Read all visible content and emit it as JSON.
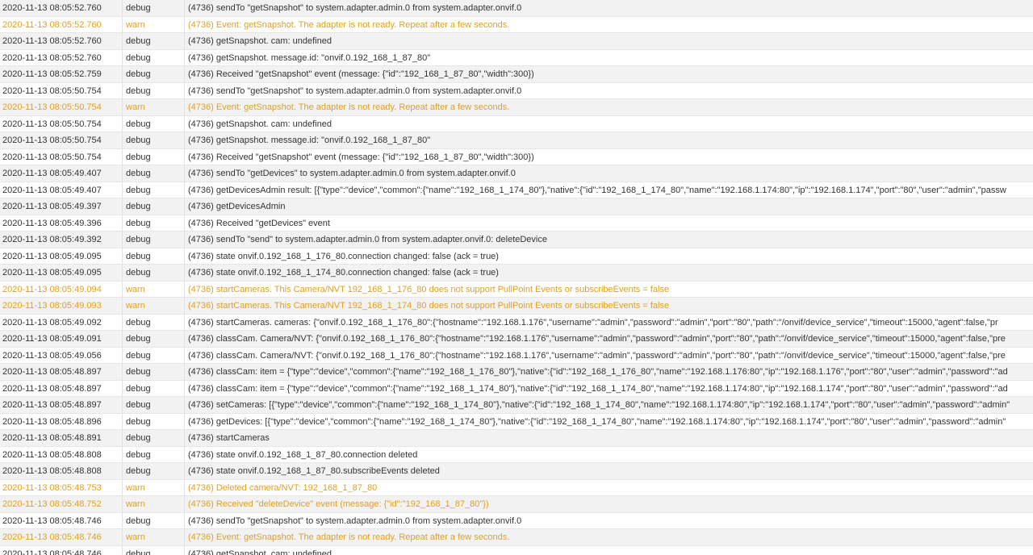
{
  "colors": {
    "debug_text": "#333333",
    "warn_text": "#e0a020",
    "row_alt_bg": "#f2f2f2",
    "row_bg": "#ffffff"
  },
  "log": {
    "rows": [
      {
        "time": "2020-11-13 08:05:52.760",
        "severity": "debug",
        "message": "(4736) sendTo \"getSnapshot\" to system.adapter.admin.0 from system.adapter.onvif.0"
      },
      {
        "time": "2020-11-13 08:05:52.760",
        "severity": "warn",
        "message": "(4736) Event: getSnapshot. The adapter is not ready. Repeat after a few seconds."
      },
      {
        "time": "2020-11-13 08:05:52.760",
        "severity": "debug",
        "message": "(4736) getSnapshot. cam: undefined"
      },
      {
        "time": "2020-11-13 08:05:52.760",
        "severity": "debug",
        "message": "(4736) getSnapshot. message.id: \"onvif.0.192_168_1_87_80\""
      },
      {
        "time": "2020-11-13 08:05:52.759",
        "severity": "debug",
        "message": "(4736) Received \"getSnapshot\" event (message: {\"id\":\"192_168_1_87_80\",\"width\":300})"
      },
      {
        "time": "2020-11-13 08:05:50.754",
        "severity": "debug",
        "message": "(4736) sendTo \"getSnapshot\" to system.adapter.admin.0 from system.adapter.onvif.0"
      },
      {
        "time": "2020-11-13 08:05:50.754",
        "severity": "warn",
        "message": "(4736) Event: getSnapshot. The adapter is not ready. Repeat after a few seconds."
      },
      {
        "time": "2020-11-13 08:05:50.754",
        "severity": "debug",
        "message": "(4736) getSnapshot. cam: undefined"
      },
      {
        "time": "2020-11-13 08:05:50.754",
        "severity": "debug",
        "message": "(4736) getSnapshot. message.id: \"onvif.0.192_168_1_87_80\""
      },
      {
        "time": "2020-11-13 08:05:50.754",
        "severity": "debug",
        "message": "(4736) Received \"getSnapshot\" event (message: {\"id\":\"192_168_1_87_80\",\"width\":300})"
      },
      {
        "time": "2020-11-13 08:05:49.407",
        "severity": "debug",
        "message": "(4736) sendTo \"getDevices\" to system.adapter.admin.0 from system.adapter.onvif.0"
      },
      {
        "time": "2020-11-13 08:05:49.407",
        "severity": "debug",
        "message": "(4736) getDevicesAdmin result: [{\"type\":\"device\",\"common\":{\"name\":\"192_168_1_174_80\"},\"native\":{\"id\":\"192_168_1_174_80\",\"name\":\"192.168.1.174:80\",\"ip\":\"192.168.1.174\",\"port\":\"80\",\"user\":\"admin\",\"passw"
      },
      {
        "time": "2020-11-13 08:05:49.397",
        "severity": "debug",
        "message": "(4736) getDevicesAdmin"
      },
      {
        "time": "2020-11-13 08:05:49.396",
        "severity": "debug",
        "message": "(4736) Received \"getDevices\" event"
      },
      {
        "time": "2020-11-13 08:05:49.392",
        "severity": "debug",
        "message": "(4736) sendTo \"send\" to system.adapter.admin.0 from system.adapter.onvif.0: deleteDevice"
      },
      {
        "time": "2020-11-13 08:05:49.095",
        "severity": "debug",
        "message": "(4736) state onvif.0.192_168_1_176_80.connection changed: false (ack = true)"
      },
      {
        "time": "2020-11-13 08:05:49.095",
        "severity": "debug",
        "message": "(4736) state onvif.0.192_168_1_174_80.connection changed: false (ack = true)"
      },
      {
        "time": "2020-11-13 08:05:49.094",
        "severity": "warn",
        "message": "(4736) startCameras. This Camera/NVT 192_168_1_176_80 does not support PullPoint Events or subscribeEvents = false"
      },
      {
        "time": "2020-11-13 08:05:49.093",
        "severity": "warn",
        "message": "(4736) startCameras. This Camera/NVT 192_168_1_174_80 does not support PullPoint Events or subscribeEvents = false"
      },
      {
        "time": "2020-11-13 08:05:49.092",
        "severity": "debug",
        "message": "(4736) startCameras. cameras: {\"onvif.0.192_168_1_176_80\":{\"hostname\":\"192.168.1.176\",\"username\":\"admin\",\"password\":\"admin\",\"port\":\"80\",\"path\":\"/onvif/device_service\",\"timeout\":15000,\"agent\":false,\"pr"
      },
      {
        "time": "2020-11-13 08:05:49.091",
        "severity": "debug",
        "message": "(4736) classCam. Camera/NVT: {\"onvif.0.192_168_1_176_80\":{\"hostname\":\"192.168.1.176\",\"username\":\"admin\",\"password\":\"admin\",\"port\":\"80\",\"path\":\"/onvif/device_service\",\"timeout\":15000,\"agent\":false,\"pre"
      },
      {
        "time": "2020-11-13 08:05:49.056",
        "severity": "debug",
        "message": "(4736) classCam. Camera/NVT: {\"onvif.0.192_168_1_176_80\":{\"hostname\":\"192.168.1.176\",\"username\":\"admin\",\"password\":\"admin\",\"port\":\"80\",\"path\":\"/onvif/device_service\",\"timeout\":15000,\"agent\":false,\"pre"
      },
      {
        "time": "2020-11-13 08:05:48.897",
        "severity": "debug",
        "message": "(4736) classCam: item = {\"type\":\"device\",\"common\":{\"name\":\"192_168_1_176_80\"},\"native\":{\"id\":\"192_168_1_176_80\",\"name\":\"192.168.1.176:80\",\"ip\":\"192.168.1.176\",\"port\":\"80\",\"user\":\"admin\",\"password\":\"ad"
      },
      {
        "time": "2020-11-13 08:05:48.897",
        "severity": "debug",
        "message": "(4736) classCam: item = {\"type\":\"device\",\"common\":{\"name\":\"192_168_1_174_80\"},\"native\":{\"id\":\"192_168_1_174_80\",\"name\":\"192.168.1.174:80\",\"ip\":\"192.168.1.174\",\"port\":\"80\",\"user\":\"admin\",\"password\":\"ad"
      },
      {
        "time": "2020-11-13 08:05:48.897",
        "severity": "debug",
        "message": "(4736) setCameras: [{\"type\":\"device\",\"common\":{\"name\":\"192_168_1_174_80\"},\"native\":{\"id\":\"192_168_1_174_80\",\"name\":\"192.168.1.174:80\",\"ip\":\"192.168.1.174\",\"port\":\"80\",\"user\":\"admin\",\"password\":\"admin\""
      },
      {
        "time": "2020-11-13 08:05:48.896",
        "severity": "debug",
        "message": "(4736) getDevices: [{\"type\":\"device\",\"common\":{\"name\":\"192_168_1_174_80\"},\"native\":{\"id\":\"192_168_1_174_80\",\"name\":\"192.168.1.174:80\",\"ip\":\"192.168.1.174\",\"port\":\"80\",\"user\":\"admin\",\"password\":\"admin\""
      },
      {
        "time": "2020-11-13 08:05:48.891",
        "severity": "debug",
        "message": "(4736) startCameras"
      },
      {
        "time": "2020-11-13 08:05:48.808",
        "severity": "debug",
        "message": "(4736) state onvif.0.192_168_1_87_80.connection deleted"
      },
      {
        "time": "2020-11-13 08:05:48.808",
        "severity": "debug",
        "message": "(4736) state onvif.0.192_168_1_87_80.subscribeEvents deleted"
      },
      {
        "time": "2020-11-13 08:05:48.753",
        "severity": "warn",
        "message": "(4736) Deleted camera/NVT: 192_168_1_87_80"
      },
      {
        "time": "2020-11-13 08:05:48.752",
        "severity": "warn",
        "message": "(4736) Received \"deleteDevice\" event (message: {\"id\":\"192_168_1_87_80\"})"
      },
      {
        "time": "2020-11-13 08:05:48.746",
        "severity": "debug",
        "message": "(4736) sendTo \"getSnapshot\" to system.adapter.admin.0 from system.adapter.onvif.0"
      },
      {
        "time": "2020-11-13 08:05:48.746",
        "severity": "warn",
        "message": "(4736) Event: getSnapshot. The adapter is not ready. Repeat after a few seconds."
      },
      {
        "time": "2020-11-13 08:05:48.746",
        "severity": "debug",
        "message": "(4736) getSnapshot. cam: undefined"
      }
    ]
  }
}
